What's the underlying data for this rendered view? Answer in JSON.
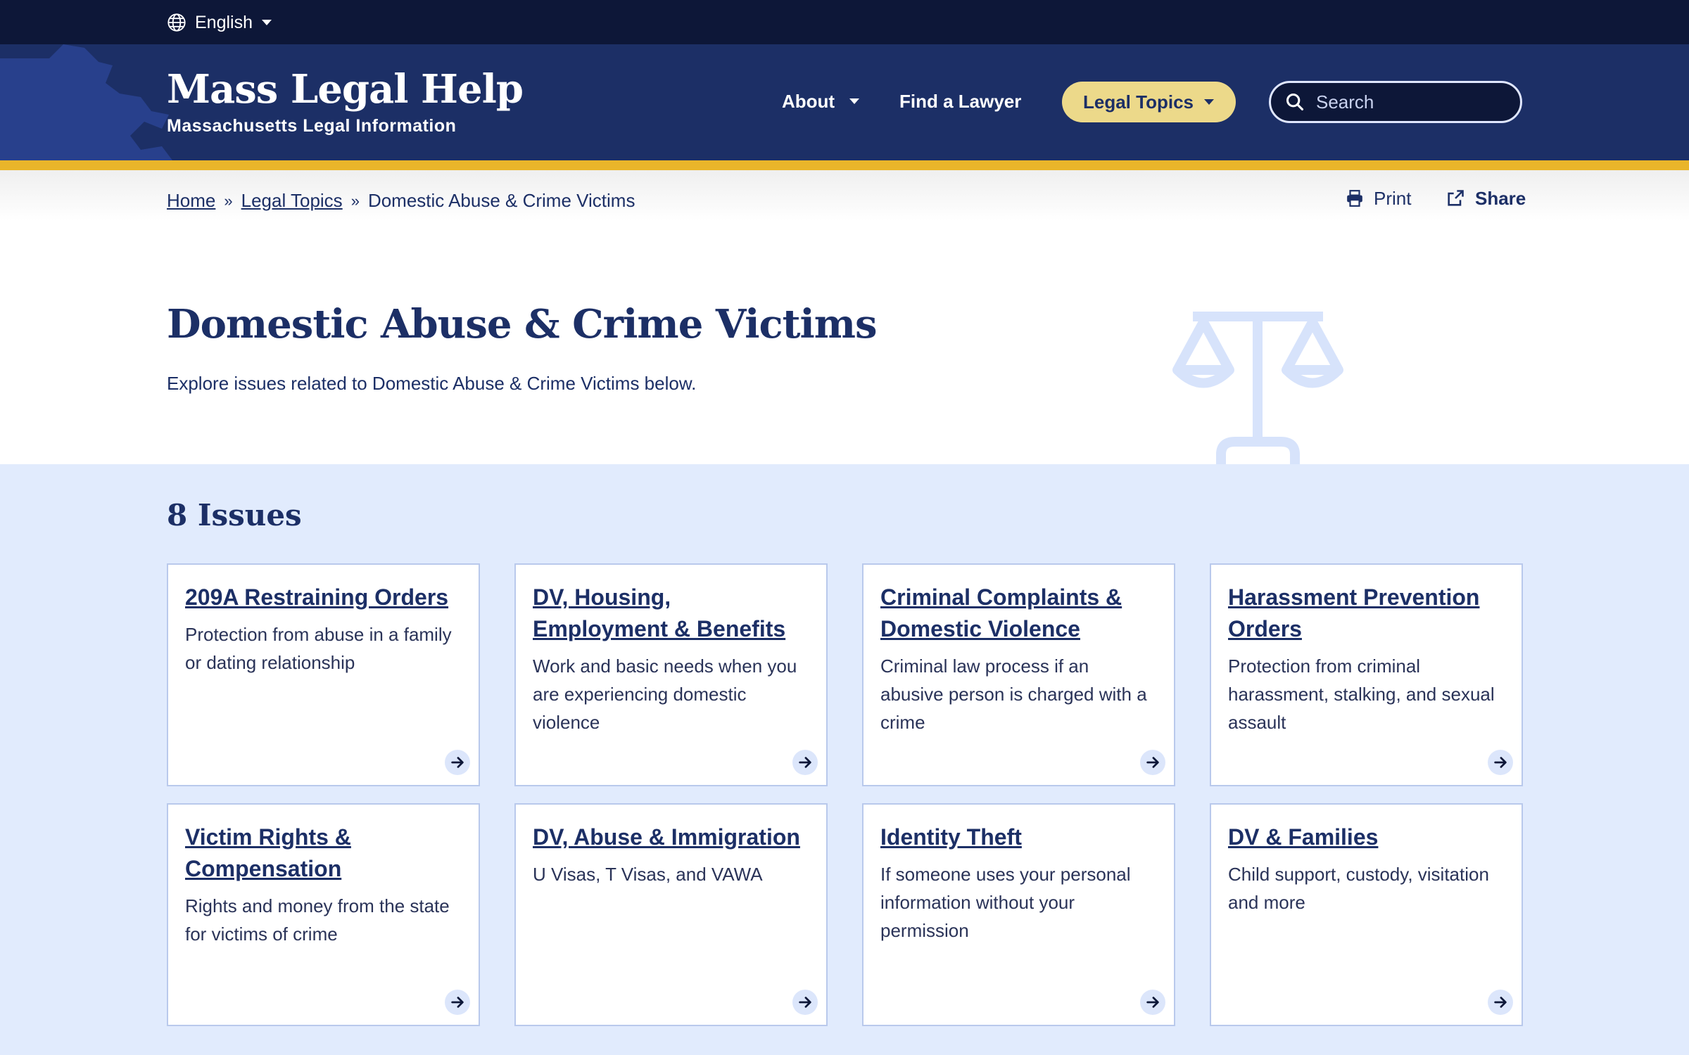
{
  "language": {
    "label": "English"
  },
  "site": {
    "title": "Mass Legal Help",
    "subtitle": "Massachusetts Legal Information"
  },
  "nav": {
    "about": "About",
    "find_lawyer": "Find a Lawyer",
    "legal_topics": "Legal Topics"
  },
  "search": {
    "placeholder": "Search"
  },
  "breadcrumb": {
    "home": "Home",
    "topics": "Legal Topics",
    "current": "Domestic Abuse & Crime Victims",
    "separator": "»"
  },
  "tools": {
    "print": "Print",
    "share": "Share"
  },
  "hero": {
    "title": "Domestic Abuse & Crime Victims",
    "description": "Explore issues related to Domestic Abuse & Crime Victims below."
  },
  "issues": {
    "heading": "8 Issues",
    "cards": [
      {
        "title": "209A Restraining Orders",
        "description": "Protection from abuse in a family or dating relationship"
      },
      {
        "title": "DV, Housing, Employment & Benefits",
        "description": "Work and basic needs when you are experiencing domestic violence"
      },
      {
        "title": "Criminal Complaints & Domestic Violence",
        "description": "Criminal law process if an abusive person is charged with a crime"
      },
      {
        "title": "Harassment Prevention Orders",
        "description": "Protection from criminal harassment, stalking, and sexual assault"
      },
      {
        "title": "Victim Rights & Compensation",
        "description": "Rights and money from the state for victims of crime"
      },
      {
        "title": "DV, Abuse & Immigration",
        "description": "U Visas, T Visas, and VAWA"
      },
      {
        "title": "Identity Theft",
        "description": "If someone uses your personal information without your permission"
      },
      {
        "title": "DV & Families",
        "description": "Child support, custody, visitation and more"
      }
    ]
  },
  "colors": {
    "navy": "#1c2f66",
    "dark_navy": "#0d1738",
    "gold": "#e9b52a",
    "topics_button": "#ecd98a",
    "section_bg": "#e1ebfd"
  },
  "icons": [
    "globe-icon",
    "caret-down-icon",
    "search-icon",
    "print-icon",
    "share-icon",
    "scales-of-justice-icon",
    "arrow-right-icon",
    "massachusetts-map-icon"
  ]
}
